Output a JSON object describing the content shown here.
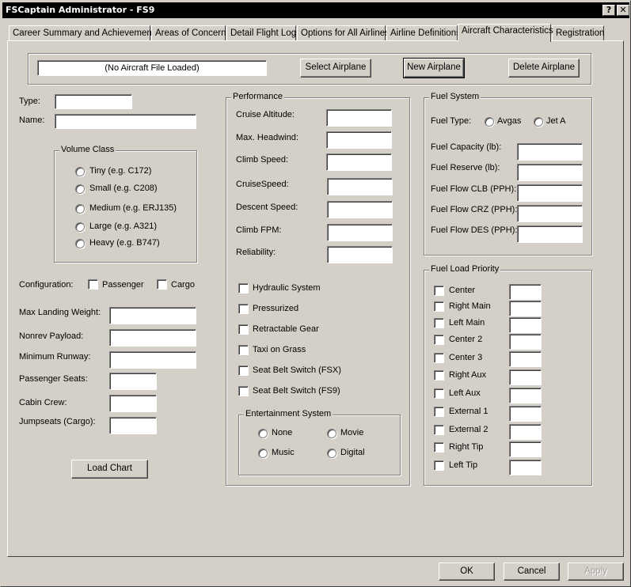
{
  "window": {
    "title": "FSCaptain Administrator - FS9",
    "help_button": "?",
    "close_button": "✕"
  },
  "tabs": [
    {
      "label": "Career Summary and Achievements",
      "active": false
    },
    {
      "label": "Areas of Concern",
      "active": false
    },
    {
      "label": "Detail Flight Log",
      "active": false
    },
    {
      "label": "Options for All Airlines",
      "active": false
    },
    {
      "label": "Airline Definitions",
      "active": false
    },
    {
      "label": "Aircraft Characteristics",
      "active": true
    },
    {
      "label": "Registration",
      "active": false
    }
  ],
  "aircraft_file": {
    "value": "(No Aircraft File Loaded)",
    "select_label": "Select Airplane",
    "new_label": "New Airplane",
    "delete_label": "Delete Airplane"
  },
  "identity": {
    "type_label": "Type:",
    "type_value": "",
    "name_label": "Name:",
    "name_value": ""
  },
  "volume_class": {
    "title": "Volume Class",
    "options": [
      "Tiny (e.g. C172)",
      "Small (e.g. C208)",
      "Medium (e.g. ERJ135)",
      "Large (e.g. A321)",
      "Heavy (e.g. B747)"
    ],
    "selected": null
  },
  "configuration": {
    "label": "Configuration:",
    "options": [
      {
        "label": "Passenger",
        "checked": false
      },
      {
        "label": "Cargo",
        "checked": false
      }
    ]
  },
  "weights": [
    {
      "label": "Max Landing Weight:",
      "value": ""
    },
    {
      "label": "Nonrev Payload:",
      "value": ""
    },
    {
      "label": "Minimum Runway:",
      "value": ""
    },
    {
      "label": "Passenger Seats:",
      "value": ""
    },
    {
      "label": "Cabin Crew:",
      "value": ""
    },
    {
      "label": "Jumpseats (Cargo):",
      "value": ""
    }
  ],
  "load_chart_label": "Load Chart",
  "performance": {
    "title": "Performance",
    "fields": [
      {
        "label": "Cruise Altitude:",
        "value": ""
      },
      {
        "label": "Max. Headwind:",
        "value": ""
      },
      {
        "label": "Climb Speed:",
        "value": ""
      },
      {
        "label": "CruiseSpeed:",
        "value": ""
      },
      {
        "label": "Descent Speed:",
        "value": ""
      },
      {
        "label": "Climb FPM:",
        "value": ""
      },
      {
        "label": "Reliability:",
        "value": ""
      }
    ],
    "checkboxes": [
      {
        "label": "Hydraulic System",
        "checked": false
      },
      {
        "label": "Pressurized",
        "checked": false
      },
      {
        "label": "Retractable Gear",
        "checked": false
      },
      {
        "label": "Taxi on Grass",
        "checked": false
      },
      {
        "label": "Seat Belt Switch (FSX)",
        "checked": false
      },
      {
        "label": "Seat Belt Switch (FS9)",
        "checked": false
      }
    ]
  },
  "entertainment": {
    "title": "Entertainment System",
    "options": [
      "None",
      "Movie",
      "Music",
      "Digital"
    ],
    "selected": null
  },
  "fuel_system": {
    "title": "Fuel System",
    "fuel_type_label": "Fuel Type:",
    "fuel_types": [
      "Avgas",
      "Jet A"
    ],
    "selected": null,
    "fields": [
      {
        "label": "Fuel Capacity (lb):",
        "value": ""
      },
      {
        "label": "Fuel Reserve (lb):",
        "value": ""
      },
      {
        "label": "Fuel Flow CLB (PPH):",
        "value": ""
      },
      {
        "label": "Fuel Flow CRZ (PPH):",
        "value": ""
      },
      {
        "label": "Fuel Flow DES (PPH):",
        "value": ""
      }
    ]
  },
  "fuel_load_priority": {
    "title": "Fuel Load Priority",
    "tanks": [
      {
        "label": "Center",
        "checked": false,
        "value": ""
      },
      {
        "label": "Right Main",
        "checked": false,
        "value": ""
      },
      {
        "label": "Left Main",
        "checked": false,
        "value": ""
      },
      {
        "label": "Center 2",
        "checked": false,
        "value": ""
      },
      {
        "label": "Center 3",
        "checked": false,
        "value": ""
      },
      {
        "label": "Right Aux",
        "checked": false,
        "value": ""
      },
      {
        "label": "Left Aux",
        "checked": false,
        "value": ""
      },
      {
        "label": "External 1",
        "checked": false,
        "value": ""
      },
      {
        "label": "External 2",
        "checked": false,
        "value": ""
      },
      {
        "label": "Right Tip",
        "checked": false,
        "value": ""
      },
      {
        "label": "Left Tip",
        "checked": false,
        "value": ""
      }
    ]
  },
  "dialog_buttons": {
    "ok": "OK",
    "cancel": "Cancel",
    "apply": "Apply"
  }
}
